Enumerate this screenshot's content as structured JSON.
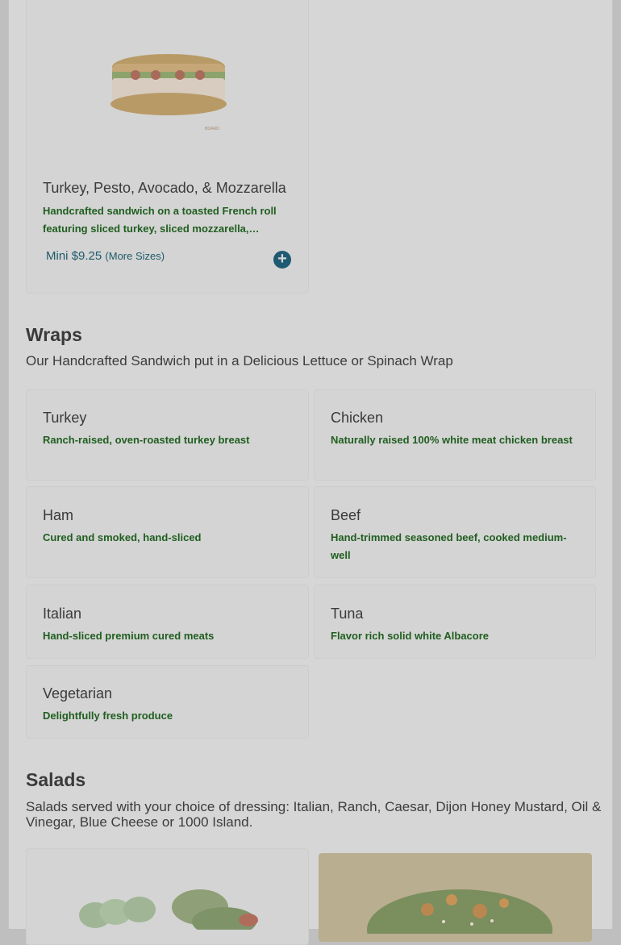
{
  "featured_item": {
    "name": "Turkey, Pesto, Avocado, & Mozzarella",
    "description": "Handcrafted sandwich on a toasted French roll featuring sliced turkey, sliced mozzarella,…",
    "price_size": "Mini",
    "price": "$9.25",
    "more_sizes": "(More Sizes)",
    "add_icon": "plus-circle-icon"
  },
  "wraps": {
    "title": "Wraps",
    "subtitle": "Our Handcrafted Sandwich put in a Delicious Lettuce or Spinach Wrap",
    "items": [
      {
        "name": "Turkey",
        "description": "Ranch-raised, oven-roasted turkey breast"
      },
      {
        "name": "Chicken",
        "description": "Naturally raised 100% white meat chicken breast"
      },
      {
        "name": "Ham",
        "description": "Cured and smoked, hand-sliced"
      },
      {
        "name": "Beef",
        "description": "Hand-trimmed seasoned beef, cooked medium-well"
      },
      {
        "name": "Italian",
        "description": "Hand-sliced premium cured meats"
      },
      {
        "name": "Tuna",
        "description": "Flavor rich solid white Albacore"
      },
      {
        "name": "Vegetarian",
        "description": "Delightfully fresh produce"
      }
    ]
  },
  "salads": {
    "title": "Salads",
    "subtitle": "Salads served with your choice of dressing: Italian, Ranch, Caesar, Dijon Honey Mustard, Oil & Vinegar, Blue Cheese or 1000 Island."
  },
  "colors": {
    "overlay_bg": "#d6d6d6",
    "description_green": "#1f5e1f",
    "price_teal": "#1e5a6a",
    "add_button": "#1e5b72"
  }
}
